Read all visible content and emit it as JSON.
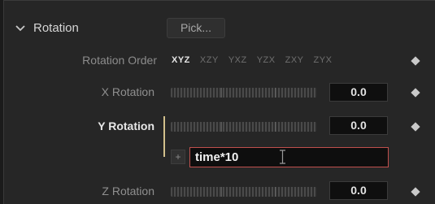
{
  "header": {
    "title": "Rotation",
    "pick_label": "Pick..."
  },
  "order": {
    "label": "Rotation Order",
    "options": [
      "XYZ",
      "XZY",
      "YXZ",
      "YZX",
      "ZXY",
      "ZYX"
    ],
    "selected": "XYZ"
  },
  "rows": [
    {
      "label": "X Rotation",
      "value": "0.0"
    },
    {
      "label": "Y Rotation",
      "value": "0.0",
      "expression": "time*10"
    },
    {
      "label": "Z Rotation",
      "value": "0.0"
    }
  ],
  "expression_add_label": "+",
  "colors": {
    "accent_bar": "#d2c08c",
    "expression_border": "#c0504d",
    "panel_bg": "#262626"
  }
}
